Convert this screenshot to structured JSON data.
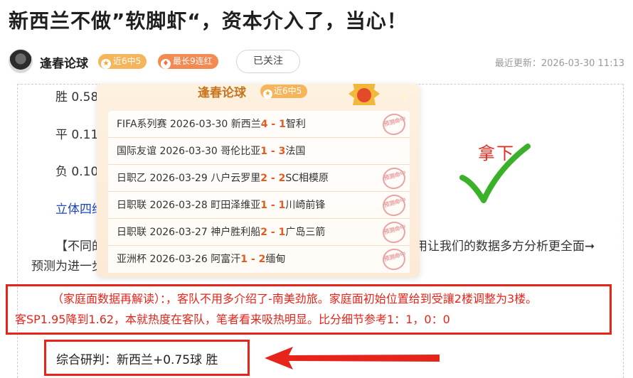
{
  "article": {
    "title": "新西兰不做”软脚虾“，资本介入了，当心！"
  },
  "author": {
    "name": "逢春论球",
    "badge_recent": "近6中5",
    "badge_streak": "最长9连红",
    "follow_label": "已关注",
    "update_label": "最近更新：2026-03-30 11:13"
  },
  "odds": {
    "win": "胜 0.58",
    "draw": "平 0.11",
    "lose": "负 0.10"
  },
  "body": {
    "link_text": "立体四维",
    "para_start": "【不同的",
    "para_tail": "用让我们的数据多方分析更全面➞",
    "para_next": "预测为进一步"
  },
  "card": {
    "title": "逢春论球",
    "badge": "近6中5",
    "stamp_label": "预测命中",
    "matches": [
      {
        "text": "FIFA系列赛 2026-03-30 新西兰",
        "score_home": "4",
        "sep": " - ",
        "score_away": "1",
        "away": "智利",
        "hit": true
      },
      {
        "text": "国际友谊 2026-03-30 哥伦比亚",
        "score_home": "1",
        "sep": " - ",
        "score_away": "3",
        "away": "法国",
        "hit": false
      },
      {
        "text": "日职乙 2026-03-29 八户云罗里",
        "score_home": "2",
        "sep": " - ",
        "score_away": "2",
        "away": "SC相模原",
        "hit": true
      },
      {
        "text": "日职联 2026-03-28 町田泽维亚",
        "score_home": "1",
        "sep": " - ",
        "score_away": "1",
        "away": "川崎前锋",
        "hit": true
      },
      {
        "text": "日职联 2026-03-27 神户胜利船",
        "score_home": "2",
        "sep": " - ",
        "score_away": "1",
        "away": "广岛三箭",
        "hit": true
      },
      {
        "text": "亚洲杯 2026-03-26 阿富汗",
        "score_home": "1",
        "sep": " - ",
        "score_away": "2",
        "away": "缅甸",
        "hit": true
      }
    ]
  },
  "annotation": {
    "na_xia": "拿下"
  },
  "analysis": {
    "line_1": "（家庭面数据再解读）：，客队不用多介绍了-南美劲旅。家庭面初始位置给到受讓2楼调整为3楼。",
    "line_2": "客SP1.95降到1.62，本就热度在客队，笔者看来吸热明显。比分细节参考1：1，0：0"
  },
  "verdict": {
    "text": "综合研判：新西兰+0.75球 胜"
  },
  "colors": {
    "accent_red": "#e6241a",
    "score_orange": "#e25a1c",
    "badge_gold": "#f5b55a",
    "badge_orange": "#f28a52",
    "link_blue": "#1a44c4"
  }
}
